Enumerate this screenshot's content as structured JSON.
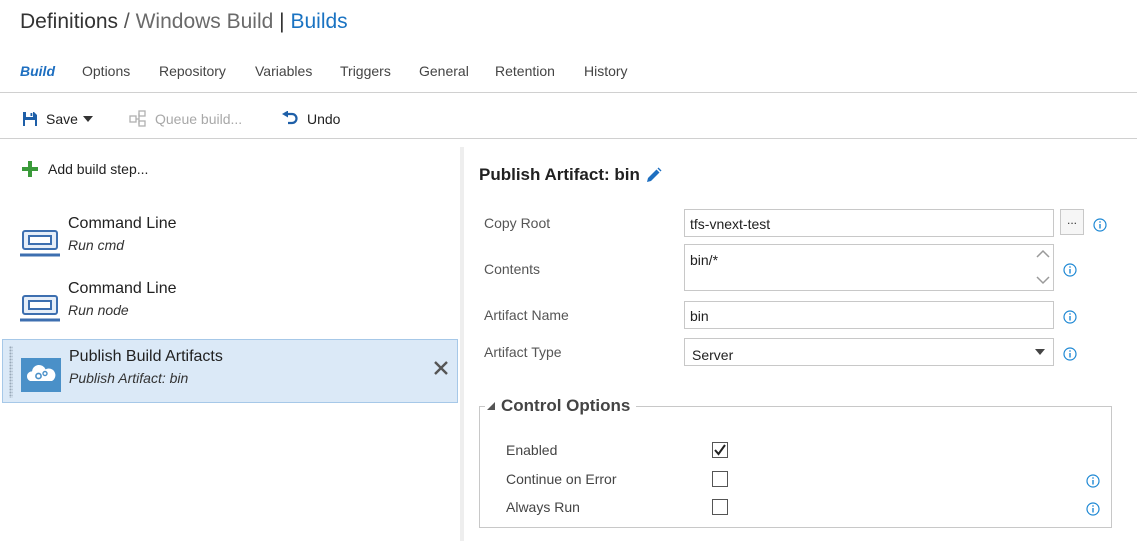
{
  "header": {
    "definitions": "Definitions",
    "separator": "/",
    "definition_name": "Windows Build",
    "pipe": "|",
    "section": "Builds"
  },
  "tabs": [
    {
      "label": "Build",
      "active": true
    },
    {
      "label": "Options"
    },
    {
      "label": "Repository"
    },
    {
      "label": "Variables"
    },
    {
      "label": "Triggers"
    },
    {
      "label": "General"
    },
    {
      "label": "Retention"
    },
    {
      "label": "History"
    }
  ],
  "toolbar": {
    "save_label": "Save",
    "queue_label": "Queue build...",
    "undo_label": "Undo"
  },
  "steps_pane": {
    "add_label": "Add build step...",
    "steps": [
      {
        "name": "Command Line",
        "subtitle": "Run cmd",
        "icon": "command-line-icon"
      },
      {
        "name": "Command Line",
        "subtitle": "Run node",
        "icon": "command-line-icon"
      },
      {
        "name": "Publish Build Artifacts",
        "subtitle": "Publish Artifact: bin",
        "icon": "publish-artifacts-icon",
        "selected": true
      }
    ]
  },
  "details": {
    "title": "Publish Artifact: bin",
    "fields": {
      "copy_root": {
        "label": "Copy Root",
        "value": "tfs-vnext-test",
        "browse": "..."
      },
      "contents": {
        "label": "Contents",
        "value": "bin/*"
      },
      "artifact_name": {
        "label": "Artifact Name",
        "value": "bin"
      },
      "artifact_type": {
        "label": "Artifact Type",
        "value": "Server"
      }
    },
    "control_options": {
      "title": "Control Options",
      "enabled": {
        "label": "Enabled",
        "checked": true
      },
      "continue_on_error": {
        "label": "Continue on Error",
        "checked": false
      },
      "always_run": {
        "label": "Always Run",
        "checked": false
      }
    }
  },
  "colors": {
    "accent": "#1a73c2",
    "selected_row": "#dbe9f7",
    "add_icon": "#3a9a3a",
    "info_icon": "#1e88d4"
  }
}
